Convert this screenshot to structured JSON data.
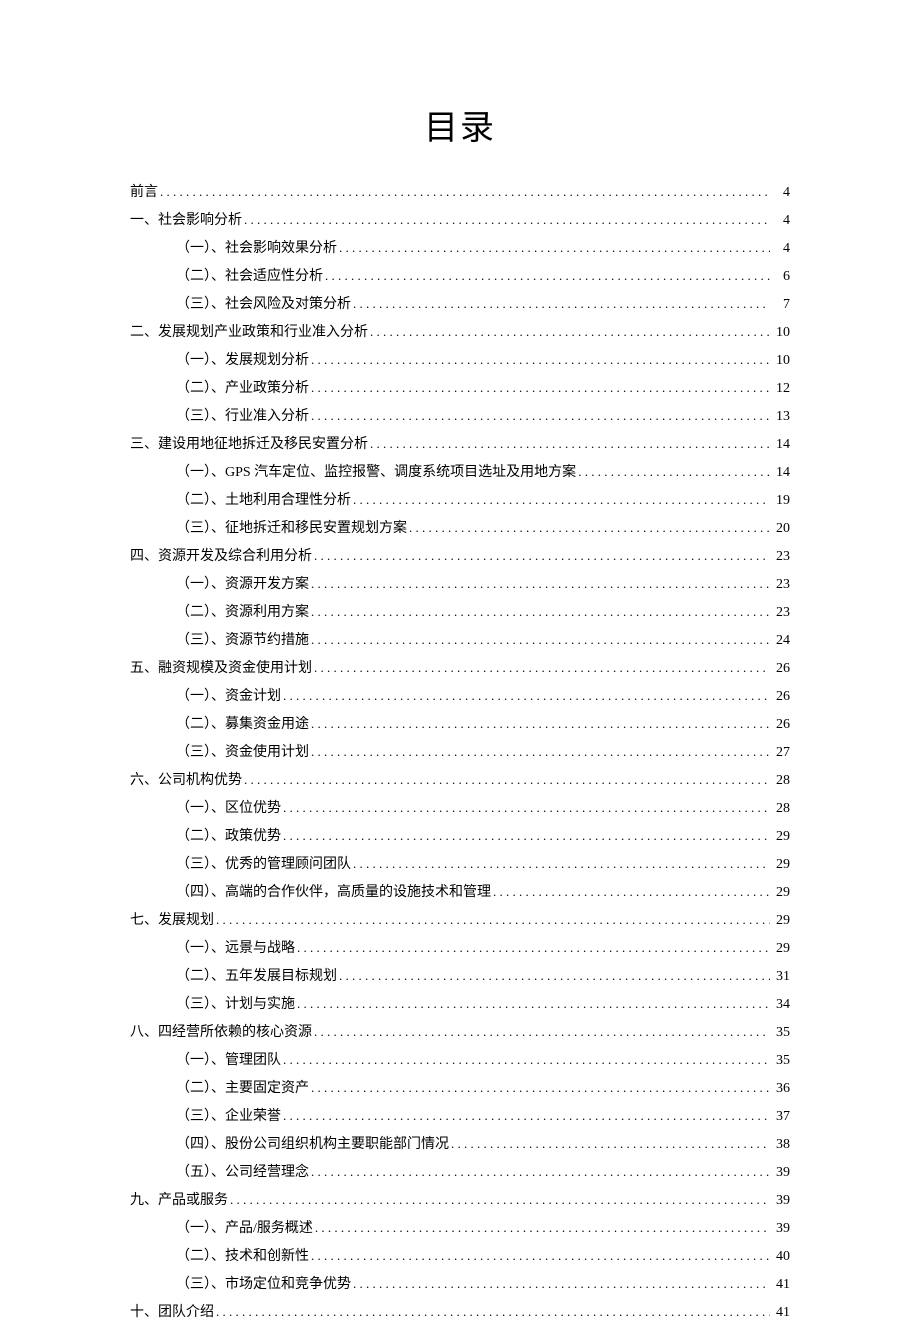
{
  "title": "目录",
  "toc": [
    {
      "level": 1,
      "text": "前言",
      "page": "4"
    },
    {
      "level": 1,
      "text": "一、社会影响分析",
      "page": "4"
    },
    {
      "level": 2,
      "text": "（一）、社会影响效果分析",
      "page": "4"
    },
    {
      "level": 2,
      "text": "（二）、社会适应性分析",
      "page": "6"
    },
    {
      "level": 2,
      "text": "（三）、社会风险及对策分析",
      "page": "7"
    },
    {
      "level": 1,
      "text": "二、发展规划产业政策和行业准入分析",
      "page": "10"
    },
    {
      "level": 2,
      "text": "（一）、发展规划分析",
      "page": "10"
    },
    {
      "level": 2,
      "text": "（二）、产业政策分析",
      "page": "12"
    },
    {
      "level": 2,
      "text": "（三）、行业准入分析",
      "page": "13"
    },
    {
      "level": 1,
      "text": "三、建设用地征地拆迁及移民安置分析",
      "page": "14"
    },
    {
      "level": 2,
      "text": "（一）、GPS 汽车定位、监控报警、调度系统项目选址及用地方案",
      "page": "14"
    },
    {
      "level": 2,
      "text": "（二）、土地利用合理性分析",
      "page": "19"
    },
    {
      "level": 2,
      "text": "（三）、征地拆迁和移民安置规划方案",
      "page": "20"
    },
    {
      "level": 1,
      "text": "四、资源开发及综合利用分析",
      "page": "23"
    },
    {
      "level": 2,
      "text": "（一）、资源开发方案",
      "page": "23"
    },
    {
      "level": 2,
      "text": "（二）、资源利用方案",
      "page": "23"
    },
    {
      "level": 2,
      "text": "（三）、资源节约措施",
      "page": "24"
    },
    {
      "level": 1,
      "text": "五、融资规模及资金使用计划",
      "page": "26"
    },
    {
      "level": 2,
      "text": "（一）、资金计划",
      "page": "26"
    },
    {
      "level": 2,
      "text": "（二）、募集资金用途",
      "page": "26"
    },
    {
      "level": 2,
      "text": "（三）、资金使用计划",
      "page": "27"
    },
    {
      "level": 1,
      "text": "六、公司机构优势",
      "page": "28"
    },
    {
      "level": 2,
      "text": "（一）、区位优势",
      "page": "28"
    },
    {
      "level": 2,
      "text": "（二）、政策优势",
      "page": "29"
    },
    {
      "level": 2,
      "text": "（三）、优秀的管理顾问团队",
      "page": "29"
    },
    {
      "level": 2,
      "text": "（四）、高端的合作伙伴，高质量的设施技术和管理",
      "page": "29"
    },
    {
      "level": 1,
      "text": "七、发展规划",
      "page": "29"
    },
    {
      "level": 2,
      "text": "（一）、远景与战略",
      "page": "29"
    },
    {
      "level": 2,
      "text": "（二）、五年发展目标规划",
      "page": "31"
    },
    {
      "level": 2,
      "text": "（三）、计划与实施",
      "page": "34"
    },
    {
      "level": 1,
      "text": "八、四经营所依赖的核心资源",
      "page": "35"
    },
    {
      "level": 2,
      "text": "（一）、管理团队",
      "page": "35"
    },
    {
      "level": 2,
      "text": "（二）、主要固定资产",
      "page": "36"
    },
    {
      "level": 2,
      "text": "（三）、企业荣誉",
      "page": "37"
    },
    {
      "level": 2,
      "text": "（四）、股份公司组织机构主要职能部门情况",
      "page": "38"
    },
    {
      "level": 2,
      "text": "（五）、公司经营理念",
      "page": "39"
    },
    {
      "level": 1,
      "text": "九、产品或服务",
      "page": "39"
    },
    {
      "level": 2,
      "text": "（一）、产品/服务概述",
      "page": "39"
    },
    {
      "level": 2,
      "text": "（二）、技术和创新性",
      "page": "40"
    },
    {
      "level": 2,
      "text": "（三）、市场定位和竞争优势",
      "page": "41"
    },
    {
      "level": 1,
      "text": "十、团队介绍",
      "page": "41"
    }
  ]
}
